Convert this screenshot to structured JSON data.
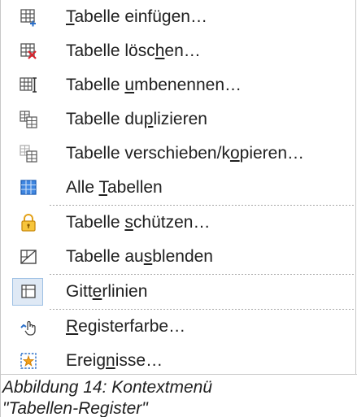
{
  "menu": {
    "items": [
      {
        "id": "insert",
        "before": "",
        "mnemonic": "T",
        "after": "abelle einfügen…",
        "icon": "insert-sheet-icon"
      },
      {
        "id": "delete",
        "before": "Tabelle lösc",
        "mnemonic": "h",
        "after": "en…",
        "icon": "delete-sheet-icon"
      },
      {
        "id": "rename",
        "before": "Tabelle ",
        "mnemonic": "u",
        "after": "mbenennen…",
        "icon": "rename-sheet-icon"
      },
      {
        "id": "duplicate",
        "before": "Tabelle du",
        "mnemonic": "p",
        "after": "lizieren",
        "icon": "duplicate-sheet-icon"
      },
      {
        "id": "move",
        "before": "Tabelle verschieben/k",
        "mnemonic": "o",
        "after": "pieren…",
        "icon": "move-sheet-icon"
      },
      {
        "id": "select_all",
        "before": "Alle ",
        "mnemonic": "T",
        "after": "abellen",
        "icon": "select-all-sheets-icon"
      },
      {
        "id": "protect",
        "before": "Tabelle ",
        "mnemonic": "s",
        "after": "chützen…",
        "icon": "lock-icon"
      },
      {
        "id": "hide",
        "before": "Tabelle au",
        "mnemonic": "s",
        "after": "blenden",
        "icon": "hide-sheet-icon"
      },
      {
        "id": "gridlines",
        "before": "Gitt",
        "mnemonic": "e",
        "after": "rlinien",
        "icon": "gridlines-icon"
      },
      {
        "id": "tab_color",
        "before": "",
        "mnemonic": "R",
        "after": "egisterfarbe…",
        "icon": "tab-color-icon"
      },
      {
        "id": "events",
        "before": "Ereig",
        "mnemonic": "n",
        "after": "isse…",
        "icon": "events-icon"
      }
    ]
  },
  "caption": {
    "line1": "Abbildung 14: Kontextmenü",
    "line2": "\"Tabellen-Register\""
  }
}
